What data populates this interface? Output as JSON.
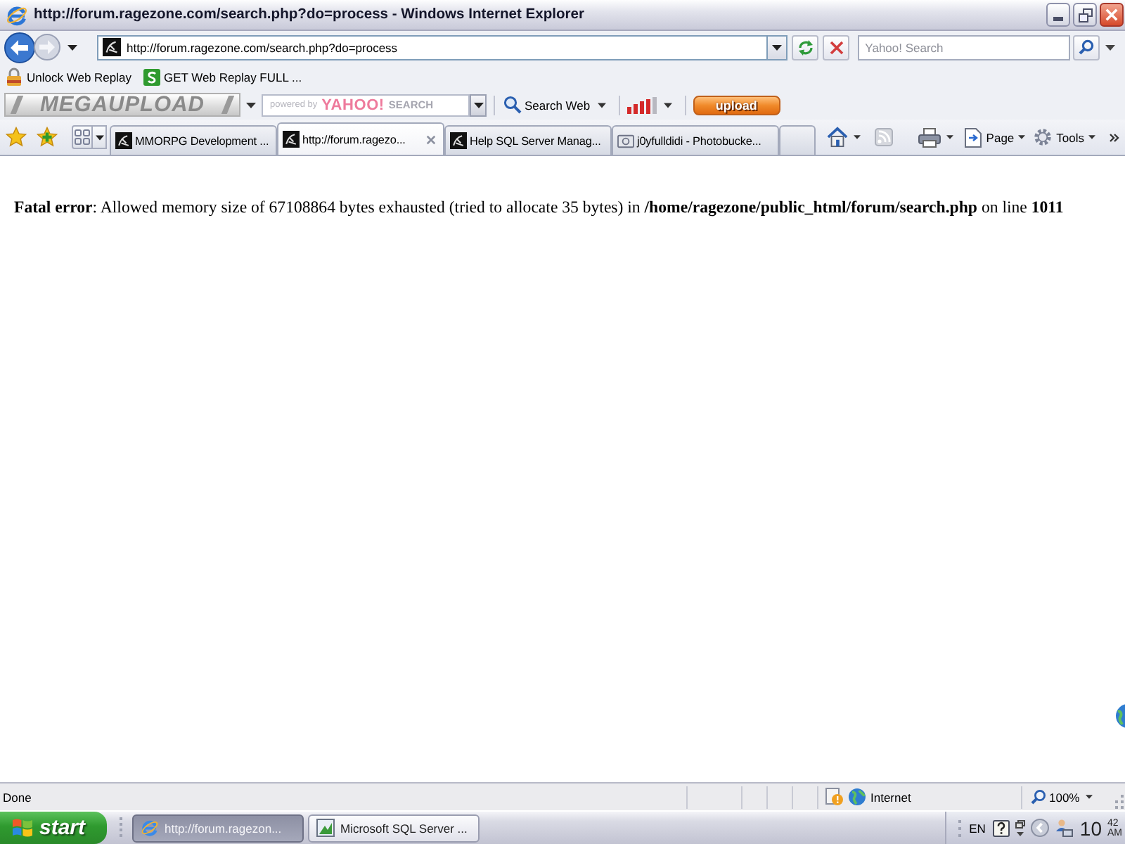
{
  "window": {
    "title": "http://forum.ragezone.com/search.php?do=process - Windows Internet Explorer"
  },
  "address_bar": {
    "url": "http://forum.ragezone.com/search.php?do=process"
  },
  "search_box": {
    "placeholder": "Yahoo! Search"
  },
  "links_bar": [
    {
      "label": "Unlock Web Replay",
      "kind": "feature"
    },
    {
      "label": "GET Web Replay FULL ...",
      "kind": "offer"
    }
  ],
  "megaupload_toolbar": {
    "logo": "MEGAUPLOAD",
    "search_field": {
      "powered_by": "powered by",
      "brand": "YAHOO!",
      "label": "SEARCH"
    },
    "search_button": "Search Web",
    "upload_button": "upload"
  },
  "tabs": [
    {
      "label": "MMORPG Development ...",
      "selected": false,
      "kind": "forum"
    },
    {
      "label": "http://forum.ragezo...",
      "selected": true,
      "kind": "forum"
    },
    {
      "label": "Help SQL Server Manag...",
      "selected": false,
      "kind": "forum"
    },
    {
      "label": "j0yfulldidi - Photobucke...",
      "selected": false,
      "kind": "gallery"
    }
  ],
  "command_bar": {
    "feeds": {
      "disabled": true
    },
    "menus": [
      {
        "label": "Page"
      },
      {
        "label": "Tools"
      }
    ]
  },
  "page": {
    "error": "**Fatal error**: Allowed memory size of 67108864 bytes exhausted (tried to allocate 35 bytes) in **/home/ragezone/public_html/forum/search.php** on line **1011**"
  },
  "status_bar": {
    "text": "Done",
    "zone": "Internet",
    "zoom": "100%"
  },
  "taskbar": {
    "start": "start",
    "tasks": [
      {
        "label": "http://forum.ragezon...",
        "selected": true,
        "kind": "browser"
      },
      {
        "label": "Microsoft SQL Server ...",
        "selected": false,
        "kind": "app"
      }
    ],
    "language": "EN",
    "clock": {
      "hour": "10",
      "minute": "42",
      "period": "AM"
    }
  }
}
